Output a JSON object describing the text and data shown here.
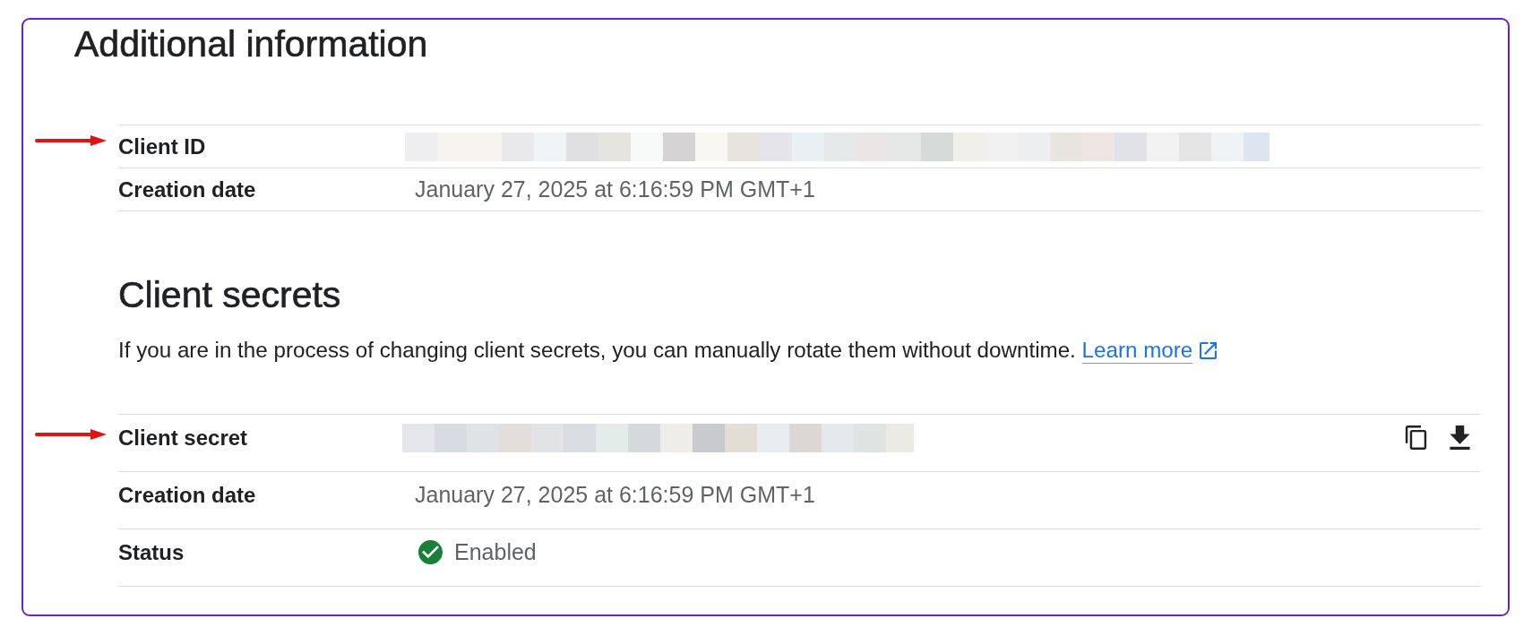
{
  "additional_information": {
    "title": "Additional information",
    "rows": [
      {
        "label": "Client ID",
        "kind": "redacted",
        "pointer_arrow": true
      },
      {
        "label": "Creation date",
        "kind": "text",
        "value": "January 27, 2025 at 6:16:59 PM GMT+1",
        "pointer_arrow": false
      }
    ]
  },
  "client_secrets": {
    "title": "Client secrets",
    "description": "If you are in the process of changing client secrets, you can manually rotate them without downtime.",
    "link": "Learn more",
    "rows": [
      {
        "label": "Client secret",
        "kind": "secret",
        "pointer_arrow": true
      },
      {
        "label": "Creation date",
        "kind": "text",
        "value": "January 27, 2025 at 6:16:59 PM GMT+1",
        "pointer_arrow": false
      },
      {
        "label": "Status",
        "kind": "status",
        "value": "Enabled",
        "pointer_arrow": false
      }
    ]
  }
}
